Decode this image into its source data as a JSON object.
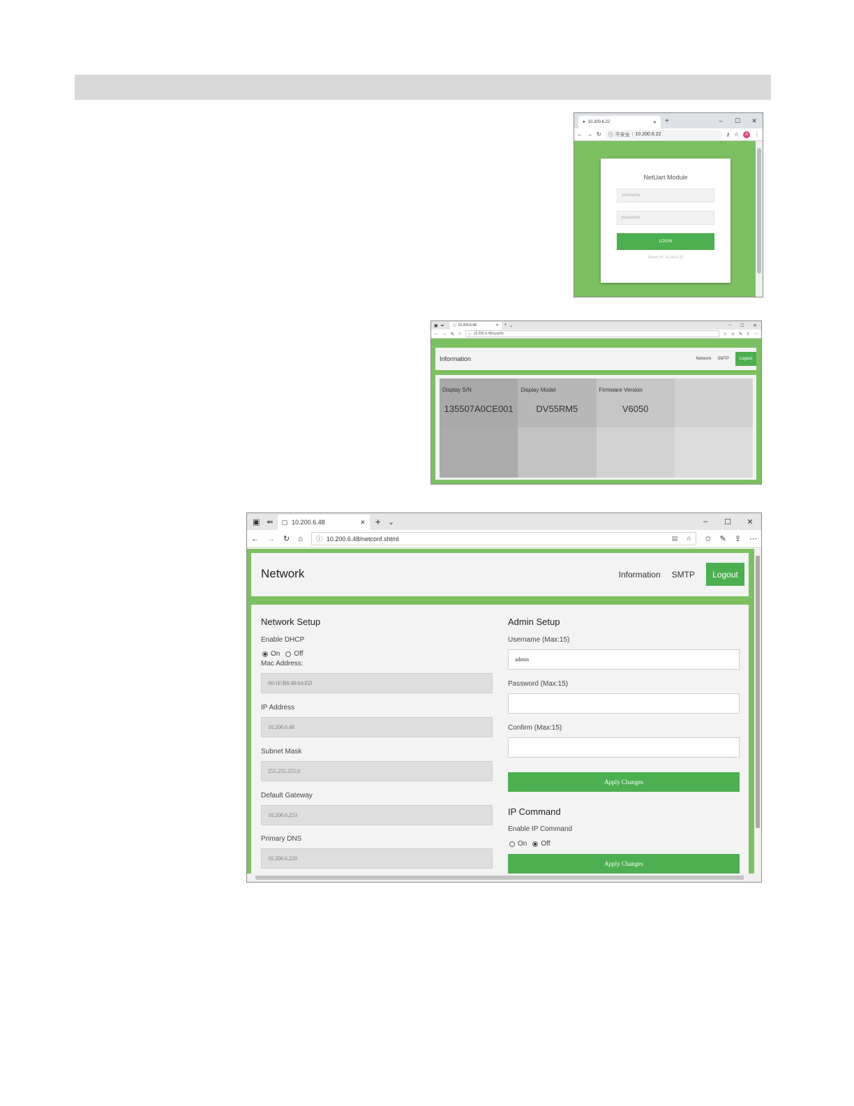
{
  "login_window": {
    "tab_title": "10.200.6.22",
    "address": "10.200.6.22",
    "security_label": "不安全",
    "avatar_letter": "A",
    "form": {
      "title": "NetUart Module",
      "username_placeholder": "username",
      "password_placeholder": "password",
      "login_label": "LOGIN",
      "device_ip_note": "Device IP: 10.200.6.22"
    },
    "colors": {
      "background": "#7cc161",
      "button": "#4caf50"
    }
  },
  "info_window": {
    "tab_title": "10.200.6.48",
    "address": "10.200.6.48/sysinfo",
    "header": {
      "title": "Information",
      "nav": [
        "Network",
        "SMTP"
      ],
      "logout_label": "Logout"
    },
    "columns": [
      {
        "label": "Display S/N",
        "value": "135507A0CE001",
        "top_color": "#a9a9a9",
        "bottom_color": "#ababab"
      },
      {
        "label": "Display Model",
        "value": "DV55RM5",
        "top_color": "#b7b7b7",
        "bottom_color": "#c2c2c2"
      },
      {
        "label": "Firmware Version",
        "value": "V6050",
        "top_color": "#c6c6c6",
        "bottom_color": "#d2d2d2"
      },
      {
        "label": "",
        "value": "",
        "top_color": "#d1d1d1",
        "bottom_color": "#dcdcdc"
      }
    ]
  },
  "network_window": {
    "tab_title": "10.200.6.48",
    "address": "10.200.6.48/netconf.shtml",
    "header": {
      "title": "Network",
      "nav": [
        "Information",
        "SMTP"
      ],
      "logout_label": "Logout"
    },
    "network_setup": {
      "title": "Network Setup",
      "dhcp_label": "Enable DHCP",
      "dhcp_on": "On",
      "dhcp_off": "Off",
      "dhcp_selected": "On",
      "mac_label": "Mac Address:",
      "mac_value": "00:1F:B6:40:04:ED",
      "ip_label": "IP Address",
      "ip_value": "10.200.6.48",
      "subnet_label": "Subnet Mask",
      "subnet_value": "255.255.255.0",
      "gateway_label": "Default Gateway",
      "gateway_value": "10.200.6.253",
      "dns_label": "Primary DNS",
      "dns_value": "10.200.6.220"
    },
    "admin_setup": {
      "title": "Admin Setup",
      "username_label": "Username (Max:15)",
      "username_value": "admin",
      "password_label": "Password (Max:15)",
      "password_value": "",
      "confirm_label": "Confirm (Max:15)",
      "confirm_value": "",
      "apply_label": "Apply Changes"
    },
    "ip_command": {
      "title": "IP Command",
      "enable_label": "Enable IP Command",
      "on": "On",
      "off": "Off",
      "selected": "Off",
      "apply_label": "Apply Changes"
    }
  },
  "icons": {
    "close": "✕",
    "new_tab": "+",
    "minimize": "–",
    "maximize": "☐",
    "back": "←",
    "forward": "→",
    "refresh": "↻",
    "home": "⌂",
    "star": "☆",
    "more": "⋯",
    "info": "ⓘ"
  }
}
